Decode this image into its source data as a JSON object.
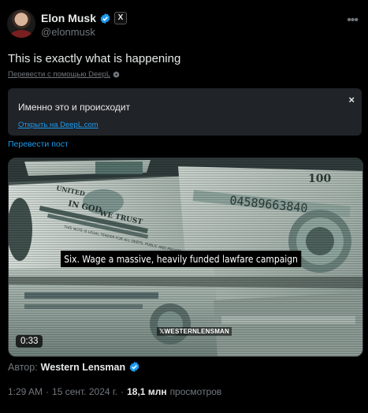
{
  "author": {
    "display_name": "Elon Musk",
    "handle": "@elonmusk",
    "x_badge": "X"
  },
  "tweet": {
    "text": "This is exactly what is happening",
    "translate_with": "Перевести с помощью DeepL",
    "translation": {
      "text": "Именно это и происходит",
      "open_link": "Открыть на DeepL.com",
      "close_glyph": "×"
    },
    "translate_post": "Перевести пост"
  },
  "media": {
    "subtitle": "Six. Wage a massive, heavily funded lawfare campaign",
    "watermark": "WESTERNLENSMAN",
    "duration": "0:33",
    "banknote_text": {
      "serial": "04589663840",
      "in_god": "IN GOD",
      "we_trust": "WE TRUST",
      "legal_tender": "THIS NOTE IS LEGAL TENDER FOR ALL DEBTS, PUBLIC AND PRIVATE",
      "united": "UNITED",
      "hundred": "100"
    }
  },
  "source": {
    "prefix": "Автор:",
    "name": "Western Lensman"
  },
  "meta": {
    "time": "1:29 AM",
    "date": "15 сент. 2024 г.",
    "separator": "·",
    "views_count": "18,1 млн",
    "views_label": "просмотров"
  },
  "colors": {
    "background": "#000000",
    "text_primary": "#e7e9ea",
    "text_secondary": "#71767b",
    "link": "#1d9bf0",
    "translation_box": "#202327",
    "verified": "#1d9bf0"
  }
}
